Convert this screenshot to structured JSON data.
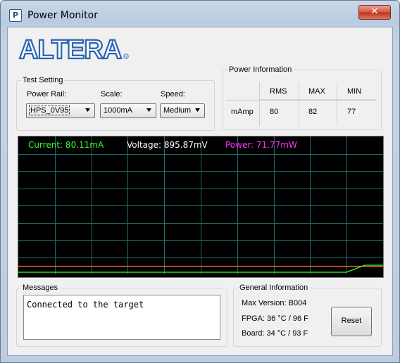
{
  "window": {
    "title": "Power Monitor",
    "close_label": "✕"
  },
  "logo": {
    "text": "ALTERA"
  },
  "test_setting": {
    "title": "Test Setting",
    "power_rail": {
      "label": "Power Rail:",
      "value": "HPS_0V95"
    },
    "scale": {
      "label": "Scale:",
      "value": "1000mA"
    },
    "speed": {
      "label": "Speed:",
      "value": "Medium"
    }
  },
  "power_info": {
    "title": "Power Information",
    "headers": [
      "RMS",
      "MAX",
      "MIN"
    ],
    "row_label": "mAmp",
    "values": [
      "80",
      "82",
      "77"
    ]
  },
  "chart": {
    "current": "Current: 80.11mA",
    "voltage": "Voltage: 895.87mV",
    "power": "Power: 71.77mW"
  },
  "chart_data": {
    "type": "line",
    "title": "",
    "xlabel": "",
    "ylabel": "",
    "grid": true,
    "series": [
      {
        "name": "Current: 80.11mA",
        "color": "#33ff33",
        "values": [
          0,
          0,
          0,
          0,
          0,
          0,
          0,
          0,
          0,
          0,
          0,
          0,
          0,
          0,
          0,
          0,
          0,
          0,
          0,
          80.11
        ]
      },
      {
        "name": "Voltage: 895.87mV",
        "color": "#ffffff",
        "values": []
      },
      {
        "name": "Power: 71.77mW",
        "color": "#ff33ff",
        "values": []
      }
    ],
    "colors": {
      "background": "#000000",
      "grid": "#1f6a6a",
      "baseline": "#ff6a1a"
    }
  },
  "messages": {
    "title": "Messages",
    "text": "Connected to the target"
  },
  "general_info": {
    "title": "General Information",
    "max_version": "Max Version:  B004",
    "fpga": "FPGA:  36 °C / 96 F",
    "board": "Board:  34 °C / 93 F",
    "reset_label": "Reset"
  }
}
